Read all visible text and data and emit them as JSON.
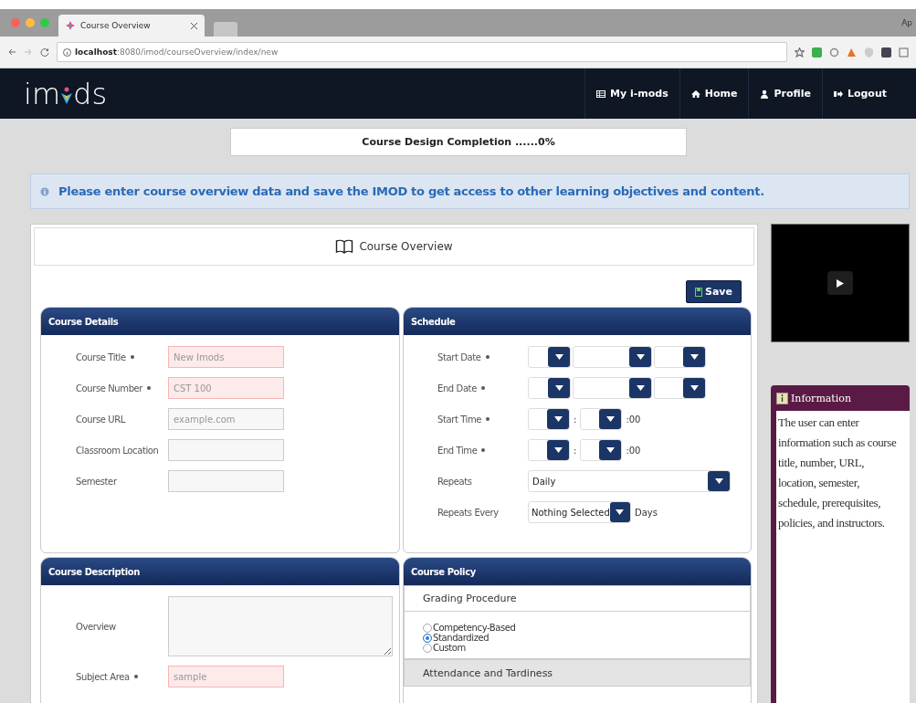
{
  "browser": {
    "tab_title": "Course Overview",
    "url_host": "localhost",
    "url_path": ":8080/imod/courseOverview/index/new",
    "corner_text": "Ap"
  },
  "navbar": {
    "logo_start": "im",
    "logo_end": "ds",
    "items": [
      {
        "label": "My i-mods",
        "kind": "grid"
      },
      {
        "label": "Home",
        "kind": "home"
      },
      {
        "label": "Profile",
        "kind": "user"
      },
      {
        "label": "Logout",
        "kind": "logout"
      }
    ]
  },
  "progress": "Course Design Completion ......0%",
  "alert": "Please enter course overview data and save the IMOD to get access to other learning objectives and content.",
  "overview_title": "Course Overview",
  "save_label": "Save",
  "course_details": {
    "title": "Course Details",
    "fields": [
      {
        "label": "Course Title",
        "required": true,
        "placeholder": "New Imods",
        "invalid": true
      },
      {
        "label": "Course Number",
        "required": true,
        "placeholder": "CST 100",
        "invalid": true
      },
      {
        "label": "Course URL",
        "required": false,
        "placeholder": "example.com",
        "invalid": false
      },
      {
        "label": "Classroom Location",
        "required": false,
        "invalid": false
      },
      {
        "label": "Semester",
        "required": false,
        "invalid": false
      }
    ]
  },
  "schedule": {
    "title": "Schedule",
    "rows": [
      {
        "label": "Start Date",
        "required": true,
        "kind": "date"
      },
      {
        "label": "End Date",
        "required": true,
        "kind": "date"
      },
      {
        "label": "Start Time",
        "required": true,
        "kind": "time",
        "separator": ":",
        "suffix": ":00"
      },
      {
        "label": "End Time",
        "required": true,
        "kind": "time",
        "separator": ":",
        "suffix": ":00"
      },
      {
        "label": "Repeats",
        "required": false,
        "kind": "select",
        "value": "Daily"
      },
      {
        "label": "Repeats Every",
        "required": false,
        "kind": "inline",
        "value": "Nothing Selected",
        "suffix": "Days"
      }
    ]
  },
  "course_description": {
    "title": "Course Description",
    "fields": [
      {
        "label": "Overview",
        "required": false,
        "kind": "textarea",
        "invalid": false
      },
      {
        "label": "Subject Area",
        "required": true,
        "kind": "input",
        "placeholder": "sample",
        "invalid": true
      }
    ]
  },
  "course_policy": {
    "title": "Course Policy",
    "sections": [
      {
        "title": "Grading Procedure",
        "expanded": true,
        "options": [
          {
            "label": "Competency-Based",
            "selected": false
          },
          {
            "label": "Standardized",
            "selected": true
          },
          {
            "label": "Custom",
            "selected": false
          }
        ]
      },
      {
        "title": "Attendance and Tardiness",
        "expanded": false
      }
    ]
  },
  "information": {
    "title": "Information",
    "text": "The user can enter information such as course title, number, URL, location, semester, schedule, prerequisites, policies, and instructors."
  }
}
